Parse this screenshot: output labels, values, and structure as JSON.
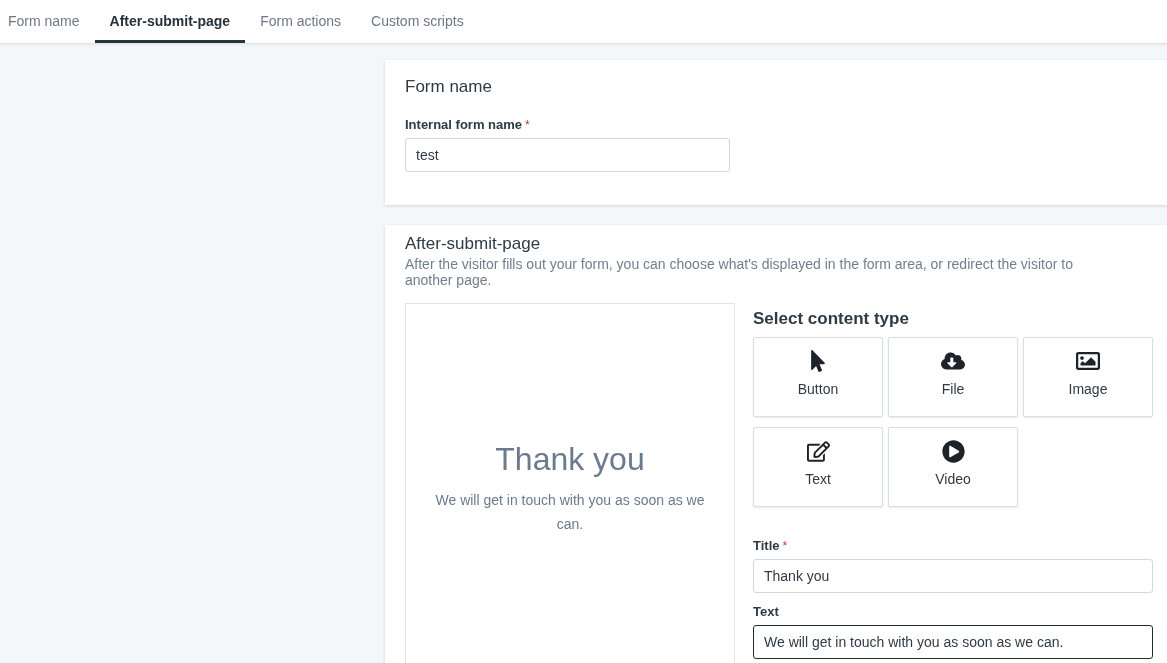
{
  "tabs": [
    {
      "label": "Form name",
      "selected": false
    },
    {
      "label": "After-submit-page",
      "selected": true
    },
    {
      "label": "Form actions",
      "selected": false
    },
    {
      "label": "Custom scripts",
      "selected": false
    }
  ],
  "form_name_card": {
    "title": "Form name",
    "field": {
      "label": "Internal form name",
      "required_mark": "*",
      "value": "test"
    }
  },
  "after_submit_card": {
    "title": "After-submit-page",
    "description": "After the visitor fills out your form, you can choose what's displayed in the form area, or redirect the visitor to another page.",
    "preview": {
      "title": "Thank you",
      "text": "We will get in touch with you as soon as we can."
    },
    "content_type": {
      "heading": "Select content type",
      "options": [
        {
          "kind": "button",
          "label": "Button"
        },
        {
          "kind": "file",
          "label": "File"
        },
        {
          "kind": "image",
          "label": "Image"
        },
        {
          "kind": "text",
          "label": "Text"
        },
        {
          "kind": "video",
          "label": "Video"
        }
      ]
    },
    "fields": [
      {
        "label": "Title",
        "required_mark": "*",
        "value": "Thank you",
        "focused": false
      },
      {
        "label": "Text",
        "value": "We will get in touch with you as soon as we can.",
        "focused": true
      }
    ]
  }
}
